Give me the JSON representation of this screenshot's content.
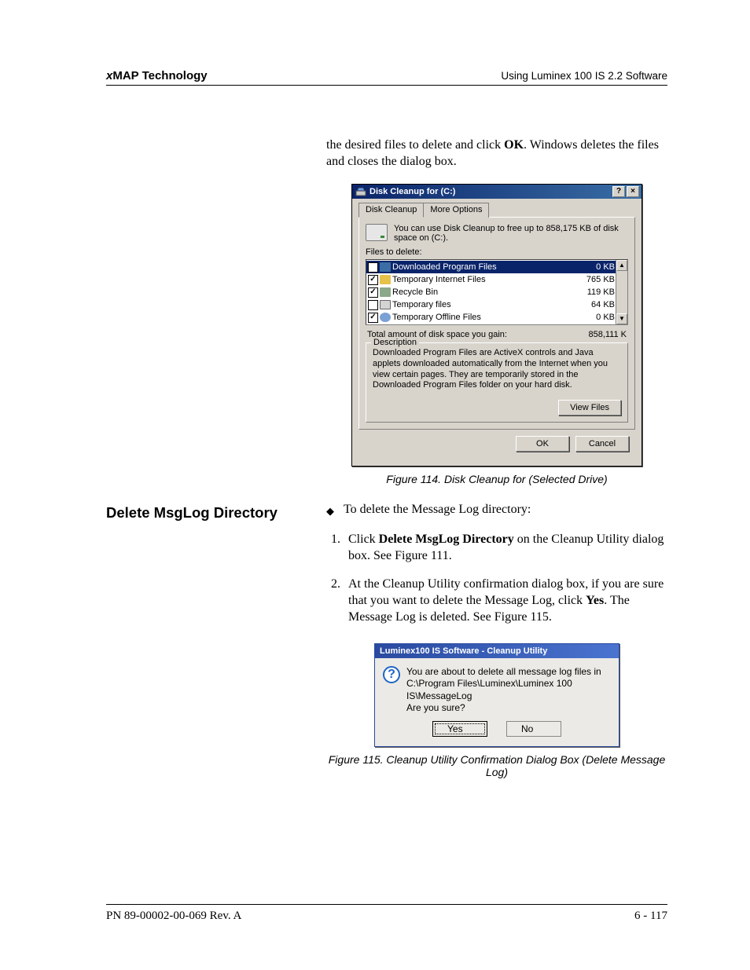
{
  "header": {
    "left_prefix": "x",
    "left_rest": "MAP Technology",
    "right": "Using Luminex 100 IS 2.2 Software"
  },
  "intro_para_a": "the desired files to delete and click ",
  "intro_para_bold": "OK",
  "intro_para_b": ". Windows deletes the files and closes the dialog box.",
  "fig114_caption": "Figure 114.  Disk Cleanup for (Selected Drive)",
  "disk_cleanup": {
    "title": "Disk Cleanup for  (C:)",
    "help_btn": "?",
    "close_btn": "×",
    "tabs": {
      "cleanup": "Disk Cleanup",
      "more": "More Options"
    },
    "intro": "You can use Disk Cleanup to free up to 858,175 KB of disk space on  (C:).",
    "files_to_delete_label": "Files to delete:",
    "items": [
      {
        "checked": true,
        "icon": "folder",
        "name": "Downloaded Program Files",
        "size": "0 KB",
        "selected": true
      },
      {
        "checked": true,
        "icon": "lock",
        "name": "Temporary Internet Files",
        "size": "765 KB",
        "selected": false
      },
      {
        "checked": true,
        "icon": "bin",
        "name": "Recycle Bin",
        "size": "119 KB",
        "selected": false
      },
      {
        "checked": false,
        "icon": "doc",
        "name": "Temporary files",
        "size": "64 KB",
        "selected": false
      },
      {
        "checked": true,
        "icon": "globe",
        "name": "Temporary Offline Files",
        "size": "0 KB",
        "selected": false
      }
    ],
    "total_label": "Total amount of disk space you gain:",
    "total_value": "858,111 K",
    "description_legend": "Description",
    "description_text": "Downloaded Program Files are ActiveX controls and Java applets downloaded automatically from the Internet when you view certain pages. They are temporarily stored in the Downloaded Program Files folder on your hard disk.",
    "view_files_btn": "View Files",
    "ok_btn": "OK",
    "cancel_btn": "Cancel"
  },
  "section_heading": "Delete MsgLog Directory",
  "bullet_text": "To delete the Message Log directory:",
  "steps": {
    "s1_a": "Click ",
    "s1_bold": "Delete MsgLog Directory",
    "s1_b": " on the Cleanup Utility dialog box. See Figure 111.",
    "s2_a": "At the Cleanup Utility confirmation dialog box, if you are sure that you want to delete the Message Log, click ",
    "s2_bold": "Yes",
    "s2_b": ". The Message Log is deleted. See Figure 115."
  },
  "confirm": {
    "title": "Luminex100 IS Software - Cleanup Utility",
    "line1": "You are about to delete all message log files in",
    "line2": "C:\\Program Files\\Luminex\\Luminex 100 IS\\MessageLog",
    "line3": "Are you sure?",
    "yes": "Yes",
    "no": "No"
  },
  "fig115_caption": "Figure 115.  Cleanup Utility Confirmation Dialog Box (Delete Message Log)",
  "footer": {
    "left": "PN 89-00002-00-069 Rev. A",
    "right": "6 - 117"
  }
}
